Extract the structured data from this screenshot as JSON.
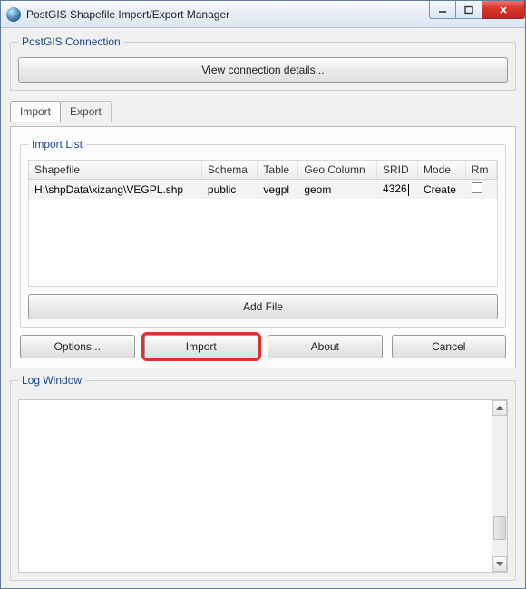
{
  "window": {
    "title": "PostGIS Shapefile Import/Export Manager"
  },
  "connection": {
    "legend": "PostGIS Connection",
    "view_details_label": "View connection details..."
  },
  "tabs": {
    "import_label": "Import",
    "export_label": "Export"
  },
  "import_list": {
    "legend": "Import List",
    "columns": {
      "shapefile": "Shapefile",
      "schema": "Schema",
      "table": "Table",
      "geocolumn": "Geo Column",
      "srid": "SRID",
      "mode": "Mode",
      "rm": "Rm"
    },
    "rows": [
      {
        "shapefile": "H:\\shpData\\xizang\\VEGPL.shp",
        "schema": "public",
        "table": "vegpl",
        "geocolumn": "geom",
        "srid": "4326",
        "mode": "Create",
        "rm": false
      }
    ],
    "add_file_label": "Add File"
  },
  "buttons": {
    "options": "Options...",
    "import": "Import",
    "about": "About",
    "cancel": "Cancel"
  },
  "log": {
    "legend": "Log Window"
  }
}
